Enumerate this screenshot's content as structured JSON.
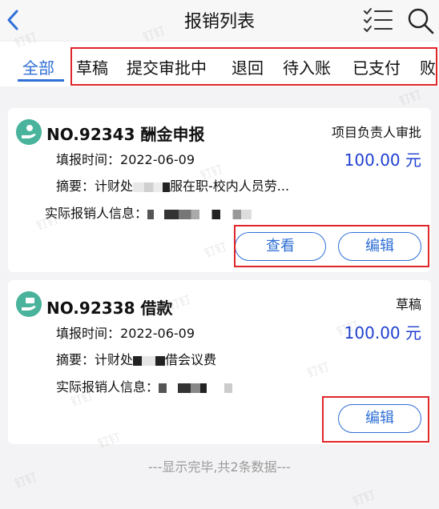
{
  "header": {
    "title": "报销列表"
  },
  "tabs": [
    {
      "label": "全部",
      "active": true
    },
    {
      "label": "草稿"
    },
    {
      "label": "提交审批中"
    },
    {
      "label": "退回"
    },
    {
      "label": "待入账"
    },
    {
      "label": "已支付"
    },
    {
      "label": "败"
    }
  ],
  "cards": [
    {
      "title": "NO.92343 酬金申报",
      "status": "项目负责人审批",
      "amount": "100.00 元",
      "date_label": "填报时间：",
      "date_value": "2022-06-09",
      "summary_label": "摘要：",
      "summary_prefix": "计财处",
      "summary_suffix": "服在职-校内人员劳...",
      "reporter_label": "实际报销人信息：",
      "buttons": [
        "查看",
        "编辑"
      ]
    },
    {
      "title": "NO.92338 借款",
      "status": "草稿",
      "amount": "100.00 元",
      "date_label": "填报时间：",
      "date_value": "2022-06-09",
      "summary_label": "摘要：",
      "summary_prefix": "计财处",
      "summary_suffix": "借会议费",
      "reporter_label": "实际报销人信息：",
      "buttons": [
        "编辑"
      ]
    }
  ],
  "footer": {
    "text": "---显示完毕,共2条数据---"
  },
  "watermark": "钉钉",
  "colors": {
    "accent": "#2f6fd6",
    "amount": "#1f3fd0",
    "highlight_box": "#e0262a",
    "card_icon": "#49b39c"
  }
}
